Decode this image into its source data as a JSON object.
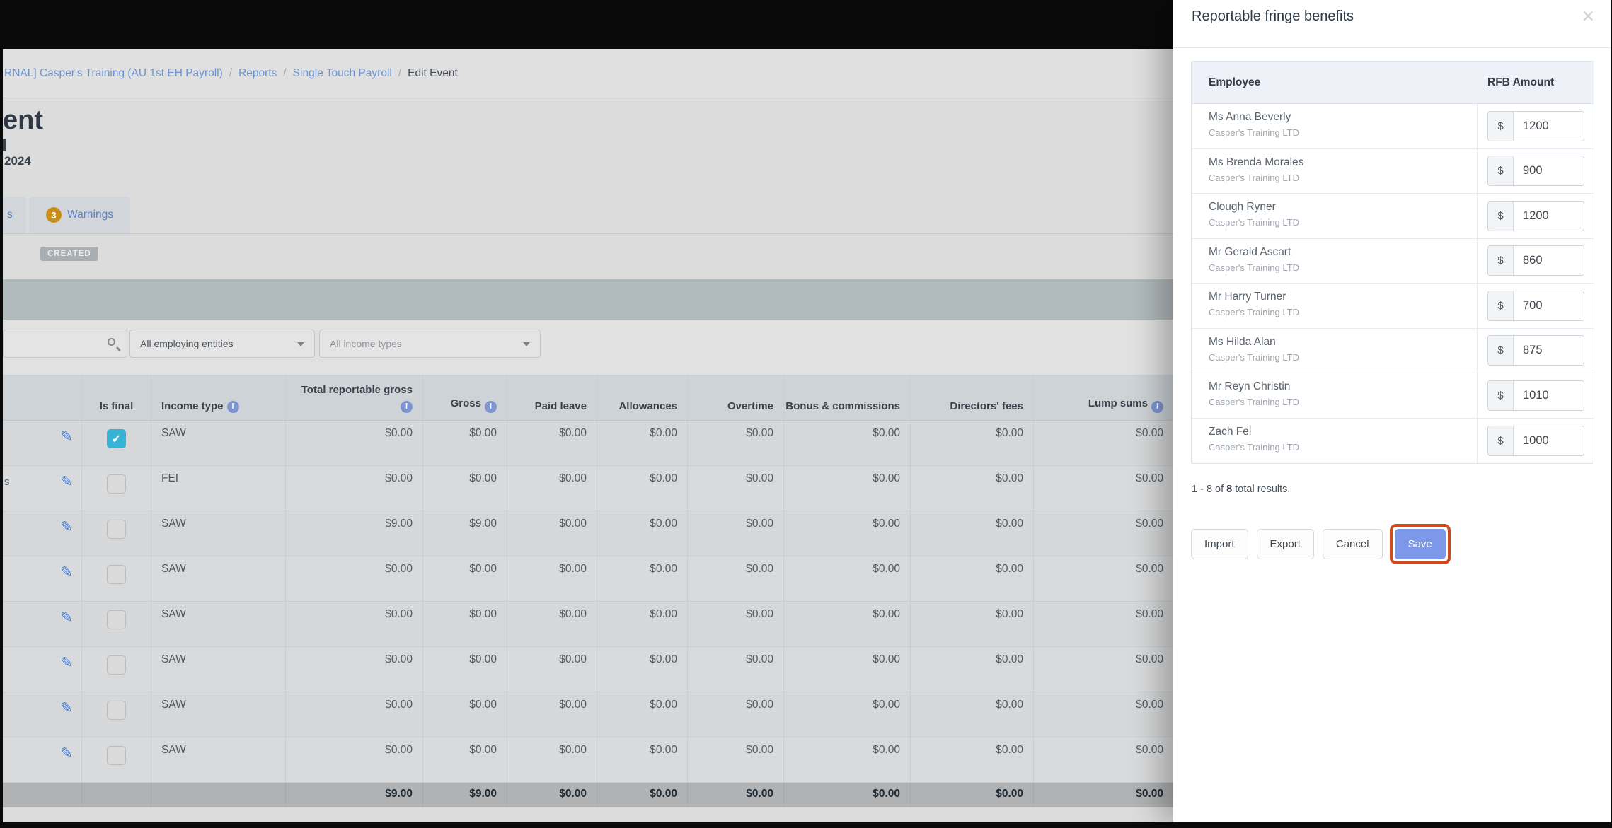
{
  "icons": {
    "close": "✕",
    "pencil": "✎",
    "check": "✓",
    "info": "i"
  },
  "colors": {
    "accent_blue": "#7d97e9",
    "highlight_orange": "#ce4a1f",
    "checked_teal": "#36b3d5",
    "warning_badge": "#c78f17"
  },
  "page": {
    "breadcrumb": {
      "links": [
        "RNAL] Casper's Training (AU 1st EH Payroll)",
        "Reports",
        "Single Touch Payroll"
      ],
      "separator": "/",
      "current": "Edit Event"
    },
    "title_fragment": "ent",
    "date_fragment": "2024",
    "tabs": {
      "cut_tab_label": "s",
      "warnings_count": "3",
      "warnings_label": "Warnings"
    },
    "status_badge": "CREATED",
    "filters": {
      "entities_value": "All employing entities",
      "income_types_value": "All income types"
    },
    "table": {
      "columns": [
        "Is final",
        "Income type",
        "Total reportable gross",
        "Gross",
        "Paid leave",
        "Allowances",
        "Overtime",
        "Bonus & commissions",
        "Directors' fees",
        "Lump sums"
      ],
      "rows": [
        {
          "fragment": "",
          "is_final": true,
          "income_type": "SAW",
          "values": [
            "$0.00",
            "$0.00",
            "$0.00",
            "$0.00",
            "$0.00",
            "$0.00",
            "$0.00",
            "$0.00"
          ]
        },
        {
          "fragment": "s",
          "is_final": false,
          "income_type": "FEI",
          "values": [
            "$0.00",
            "$0.00",
            "$0.00",
            "$0.00",
            "$0.00",
            "$0.00",
            "$0.00",
            "$0.00"
          ]
        },
        {
          "fragment": "",
          "is_final": false,
          "income_type": "SAW",
          "values": [
            "$9.00",
            "$9.00",
            "$0.00",
            "$0.00",
            "$0.00",
            "$0.00",
            "$0.00",
            "$0.00"
          ]
        },
        {
          "fragment": "",
          "is_final": false,
          "income_type": "SAW",
          "values": [
            "$0.00",
            "$0.00",
            "$0.00",
            "$0.00",
            "$0.00",
            "$0.00",
            "$0.00",
            "$0.00"
          ]
        },
        {
          "fragment": "",
          "is_final": false,
          "income_type": "SAW",
          "values": [
            "$0.00",
            "$0.00",
            "$0.00",
            "$0.00",
            "$0.00",
            "$0.00",
            "$0.00",
            "$0.00"
          ]
        },
        {
          "fragment": "",
          "is_final": false,
          "income_type": "SAW",
          "values": [
            "$0.00",
            "$0.00",
            "$0.00",
            "$0.00",
            "$0.00",
            "$0.00",
            "$0.00",
            "$0.00"
          ]
        },
        {
          "fragment": "",
          "is_final": false,
          "income_type": "SAW",
          "values": [
            "$0.00",
            "$0.00",
            "$0.00",
            "$0.00",
            "$0.00",
            "$0.00",
            "$0.00",
            "$0.00"
          ]
        },
        {
          "fragment": "",
          "is_final": false,
          "income_type": "SAW",
          "values": [
            "$0.00",
            "$0.00",
            "$0.00",
            "$0.00",
            "$0.00",
            "$0.00",
            "$0.00",
            "$0.00"
          ]
        }
      ],
      "totals": [
        "$9.00",
        "$9.00",
        "$0.00",
        "$0.00",
        "$0.00",
        "$0.00",
        "$0.00",
        "$0.00"
      ]
    }
  },
  "modal": {
    "title": "Reportable fringe benefits",
    "columns": [
      "Employee",
      "RFB Amount"
    ],
    "currency": "$",
    "rows": [
      {
        "name": "Ms Anna Beverly",
        "company": "Casper's Training LTD",
        "amount": "1200"
      },
      {
        "name": "Ms Brenda Morales",
        "company": "Casper's Training LTD",
        "amount": "900"
      },
      {
        "name": "Clough Ryner",
        "company": "Casper's Training LTD",
        "amount": "1200"
      },
      {
        "name": "Mr Gerald Ascart",
        "company": "Casper's Training LTD",
        "amount": "860"
      },
      {
        "name": "Mr Harry Turner",
        "company": "Casper's Training LTD",
        "amount": "700"
      },
      {
        "name": "Ms Hilda Alan",
        "company": "Casper's Training LTD",
        "amount": "875"
      },
      {
        "name": "Mr Reyn Christin",
        "company": "Casper's Training LTD",
        "amount": "1010"
      },
      {
        "name": "Zach Fei",
        "company": "Casper's Training LTD",
        "amount": "1000"
      }
    ],
    "results": {
      "prefix": "1 - 8 of ",
      "total": "8",
      "suffix": " total results."
    },
    "buttons": {
      "import": "Import",
      "export": "Export",
      "cancel": "Cancel",
      "save": "Save"
    }
  }
}
